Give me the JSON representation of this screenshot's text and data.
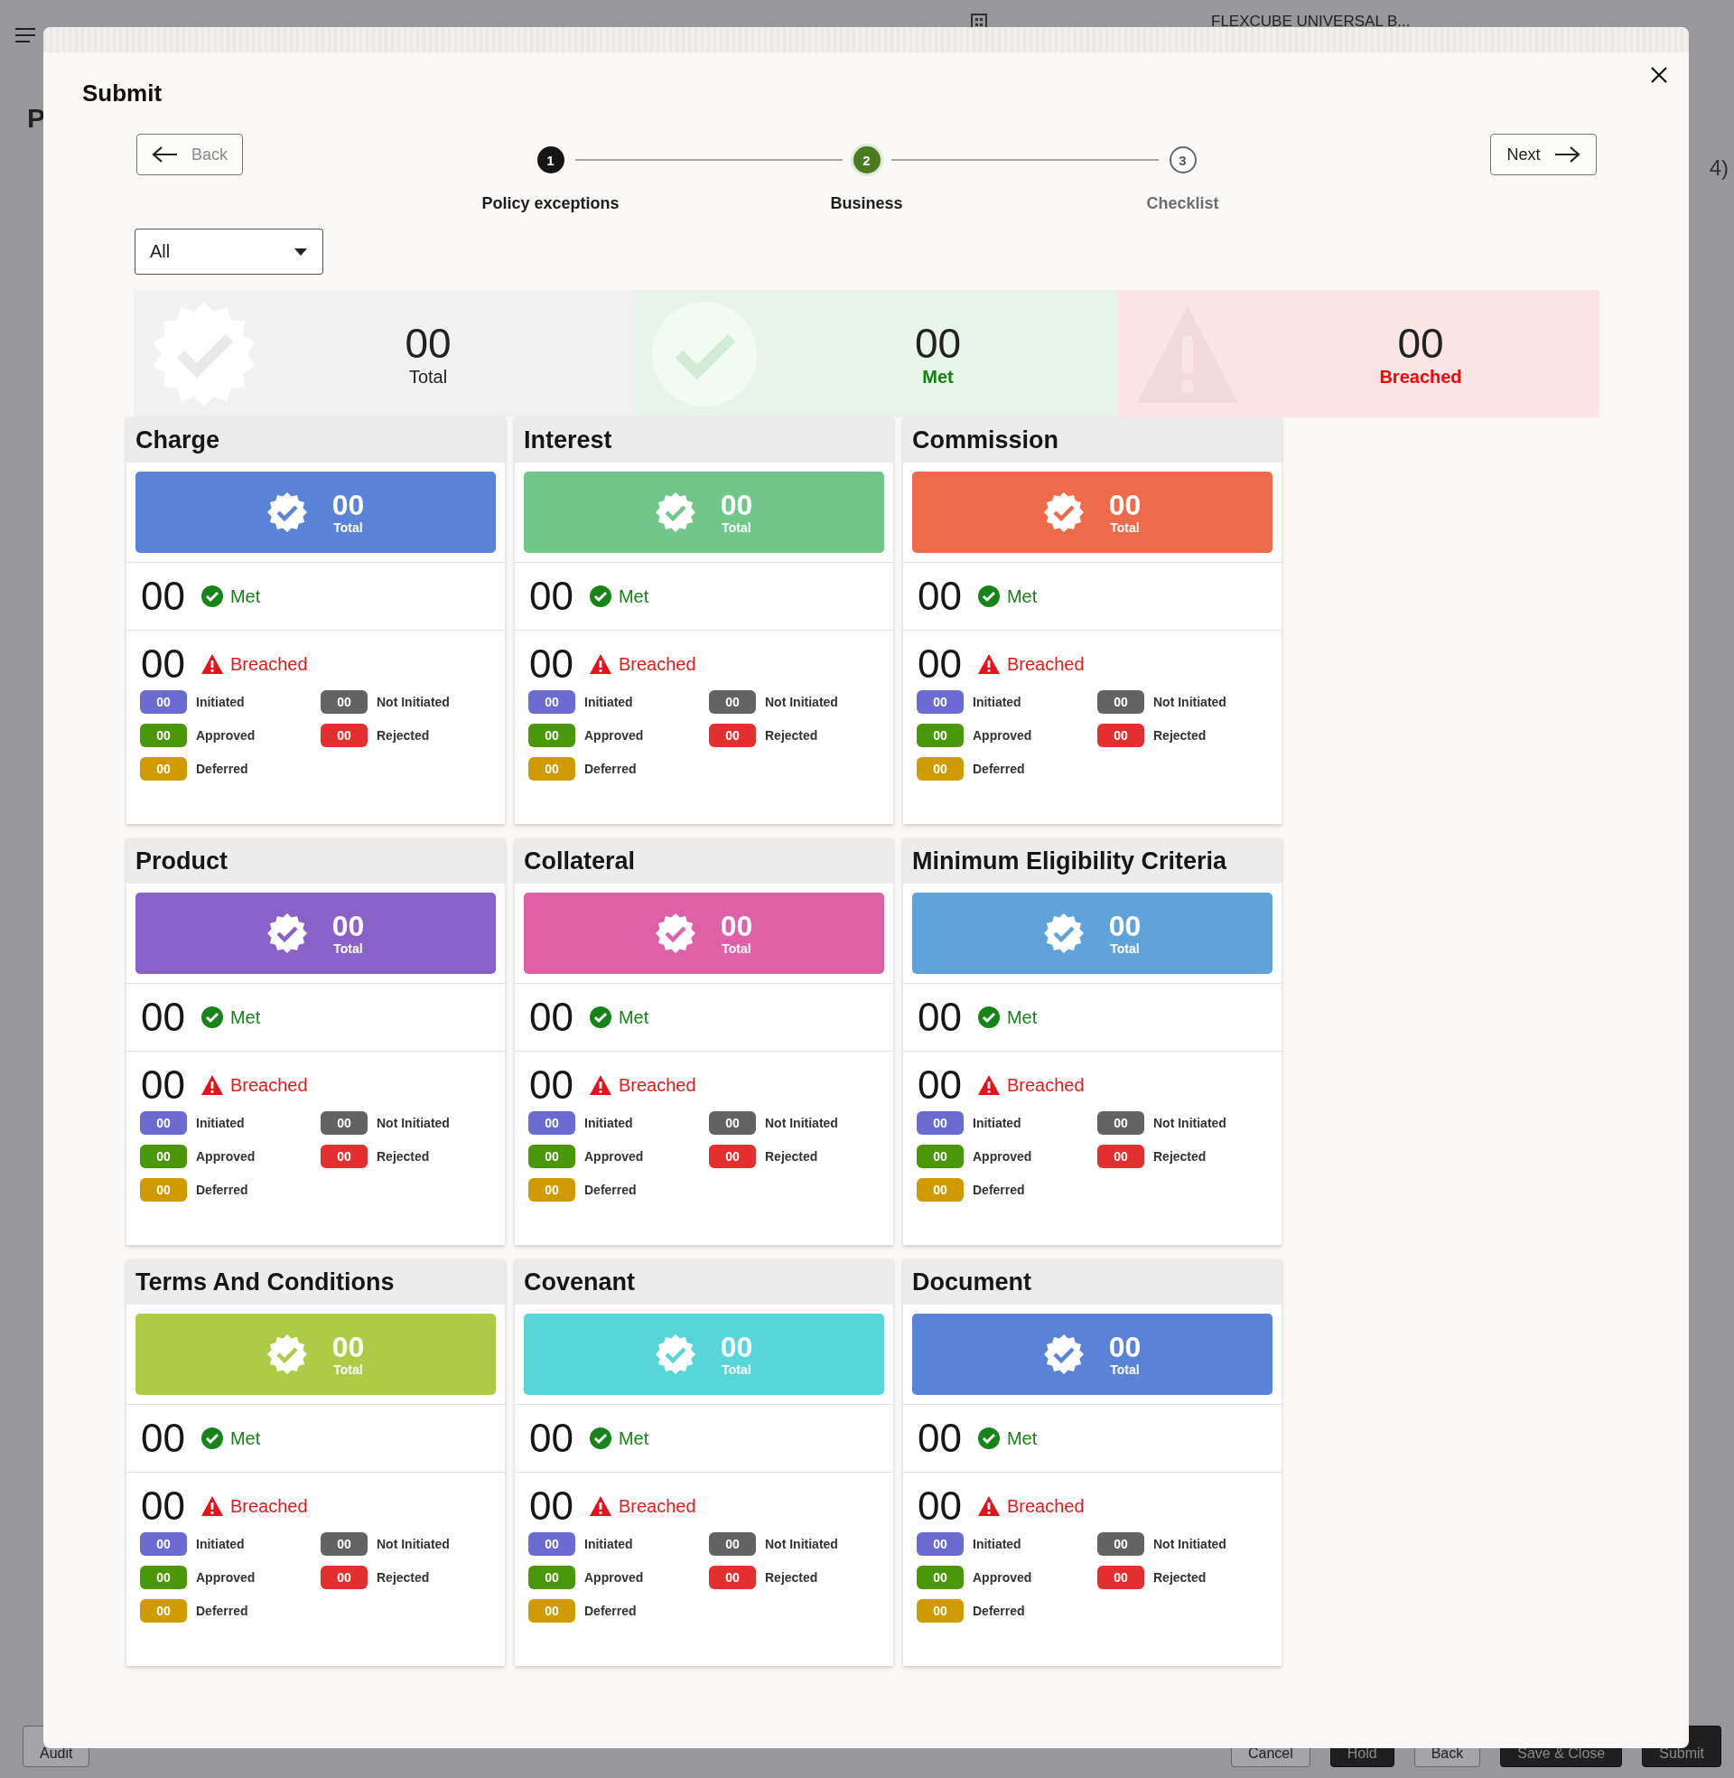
{
  "app_header": {
    "title": "FLEXCUBE UNIVERSAL B..."
  },
  "background_page": {
    "heading": "P",
    "count": "4)"
  },
  "modal": {
    "title": "Submit",
    "back_button": "Back",
    "next_button": "Next",
    "steps": [
      {
        "number": "1",
        "label": "Policy exceptions",
        "completed": true,
        "selected": false
      },
      {
        "number": "2",
        "label": "Business",
        "completed": false,
        "selected": true
      },
      {
        "number": "3",
        "label": "Checklist",
        "completed": false,
        "selected": false
      }
    ],
    "filter": {
      "value": "All"
    },
    "summary": [
      {
        "kind": "total",
        "count": "00",
        "label": "Total"
      },
      {
        "kind": "met",
        "count": "00",
        "label": "Met"
      },
      {
        "kind": "breached",
        "count": "00",
        "label": "Breached"
      }
    ],
    "categories": [
      {
        "title": "Charge",
        "color": "#5a82d6",
        "total": "00",
        "total_label": "Total",
        "met": "00",
        "met_label": "Met",
        "breached": "00",
        "breached_label": "Breached",
        "statuses": [
          {
            "count": "00",
            "label": "Initiated",
            "color": "#6b6bd1"
          },
          {
            "count": "00",
            "label": "Not Initiated",
            "color": "#636363"
          },
          {
            "count": "00",
            "label": "Approved",
            "color": "#4a980a"
          },
          {
            "count": "00",
            "label": "Rejected",
            "color": "#e32f2f"
          },
          {
            "count": "00",
            "label": "Deferred",
            "color": "#cf9b00"
          }
        ]
      },
      {
        "title": "Interest",
        "color": "#71c68a",
        "total": "00",
        "total_label": "Total",
        "met": "00",
        "met_label": "Met",
        "breached": "00",
        "breached_label": "Breached",
        "statuses": [
          {
            "count": "00",
            "label": "Initiated",
            "color": "#6b6bd1"
          },
          {
            "count": "00",
            "label": "Not Initiated",
            "color": "#636363"
          },
          {
            "count": "00",
            "label": "Approved",
            "color": "#4a980a"
          },
          {
            "count": "00",
            "label": "Rejected",
            "color": "#e32f2f"
          },
          {
            "count": "00",
            "label": "Deferred",
            "color": "#cf9b00"
          }
        ]
      },
      {
        "title": "Commission",
        "color": "#ee6a4a",
        "total": "00",
        "total_label": "Total",
        "met": "00",
        "met_label": "Met",
        "breached": "00",
        "breached_label": "Breached",
        "statuses": [
          {
            "count": "00",
            "label": "Initiated",
            "color": "#6b6bd1"
          },
          {
            "count": "00",
            "label": "Not Initiated",
            "color": "#636363"
          },
          {
            "count": "00",
            "label": "Approved",
            "color": "#4a980a"
          },
          {
            "count": "00",
            "label": "Rejected",
            "color": "#e32f2f"
          },
          {
            "count": "00",
            "label": "Deferred",
            "color": "#cf9b00"
          }
        ]
      },
      {
        "title": "Product",
        "color": "#8862c9",
        "total": "00",
        "total_label": "Total",
        "met": "00",
        "met_label": "Met",
        "breached": "00",
        "breached_label": "Breached",
        "statuses": [
          {
            "count": "00",
            "label": "Initiated",
            "color": "#6b6bd1"
          },
          {
            "count": "00",
            "label": "Not Initiated",
            "color": "#636363"
          },
          {
            "count": "00",
            "label": "Approved",
            "color": "#4a980a"
          },
          {
            "count": "00",
            "label": "Rejected",
            "color": "#e32f2f"
          },
          {
            "count": "00",
            "label": "Deferred",
            "color": "#cf9b00"
          }
        ]
      },
      {
        "title": "Collateral",
        "color": "#e060a8",
        "total": "00",
        "total_label": "Total",
        "met": "00",
        "met_label": "Met",
        "breached": "00",
        "breached_label": "Breached",
        "statuses": [
          {
            "count": "00",
            "label": "Initiated",
            "color": "#6b6bd1"
          },
          {
            "count": "00",
            "label": "Not Initiated",
            "color": "#636363"
          },
          {
            "count": "00",
            "label": "Approved",
            "color": "#4a980a"
          },
          {
            "count": "00",
            "label": "Rejected",
            "color": "#e32f2f"
          },
          {
            "count": "00",
            "label": "Deferred",
            "color": "#cf9b00"
          }
        ]
      },
      {
        "title": "Minimum Eligibility Criteria",
        "color": "#60a3da",
        "total": "00",
        "total_label": "Total",
        "met": "00",
        "met_label": "Met",
        "breached": "00",
        "breached_label": "Breached",
        "statuses": [
          {
            "count": "00",
            "label": "Initiated",
            "color": "#6b6bd1"
          },
          {
            "count": "00",
            "label": "Not Initiated",
            "color": "#636363"
          },
          {
            "count": "00",
            "label": "Approved",
            "color": "#4a980a"
          },
          {
            "count": "00",
            "label": "Rejected",
            "color": "#e32f2f"
          },
          {
            "count": "00",
            "label": "Deferred",
            "color": "#cf9b00"
          }
        ]
      },
      {
        "title": "Terms And Conditions",
        "color": "#aecb48",
        "total": "00",
        "total_label": "Total",
        "met": "00",
        "met_label": "Met",
        "breached": "00",
        "breached_label": "Breached",
        "statuses": [
          {
            "count": "00",
            "label": "Initiated",
            "color": "#6b6bd1"
          },
          {
            "count": "00",
            "label": "Not Initiated",
            "color": "#636363"
          },
          {
            "count": "00",
            "label": "Approved",
            "color": "#4a980a"
          },
          {
            "count": "00",
            "label": "Rejected",
            "color": "#e32f2f"
          },
          {
            "count": "00",
            "label": "Deferred",
            "color": "#cf9b00"
          }
        ]
      },
      {
        "title": "Covenant",
        "color": "#58d5d6",
        "total": "00",
        "total_label": "Total",
        "met": "00",
        "met_label": "Met",
        "breached": "00",
        "breached_label": "Breached",
        "statuses": [
          {
            "count": "00",
            "label": "Initiated",
            "color": "#6b6bd1"
          },
          {
            "count": "00",
            "label": "Not Initiated",
            "color": "#636363"
          },
          {
            "count": "00",
            "label": "Approved",
            "color": "#4a980a"
          },
          {
            "count": "00",
            "label": "Rejected",
            "color": "#e32f2f"
          },
          {
            "count": "00",
            "label": "Deferred",
            "color": "#cf9b00"
          }
        ]
      },
      {
        "title": "Document",
        "color": "#5a82d6",
        "total": "00",
        "total_label": "Total",
        "met": "00",
        "met_label": "Met",
        "breached": "00",
        "breached_label": "Breached",
        "statuses": [
          {
            "count": "00",
            "label": "Initiated",
            "color": "#6b6bd1"
          },
          {
            "count": "00",
            "label": "Not Initiated",
            "color": "#636363"
          },
          {
            "count": "00",
            "label": "Approved",
            "color": "#4a980a"
          },
          {
            "count": "00",
            "label": "Rejected",
            "color": "#e32f2f"
          },
          {
            "count": "00",
            "label": "Deferred",
            "color": "#cf9b00"
          }
        ]
      }
    ]
  },
  "footer": {
    "left_buttons": [
      "Audit"
    ],
    "right_buttons": [
      "Cancel",
      "Hold",
      "Back",
      "Save & Close",
      "Submit"
    ]
  }
}
